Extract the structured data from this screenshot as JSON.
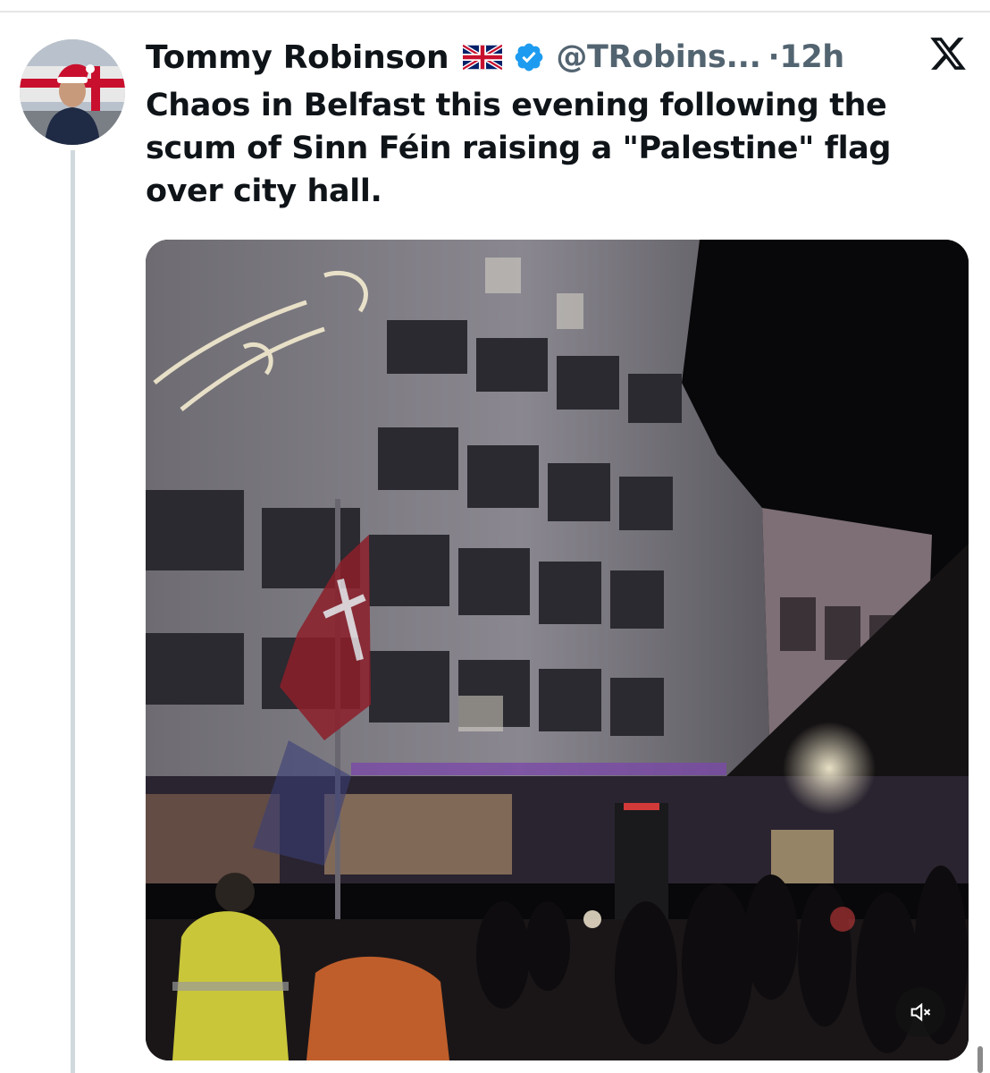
{
  "tweet": {
    "author": {
      "display_name": "Tommy Robinson",
      "handle": "@TRobins...",
      "flag_icon": "union-jack-flag-icon",
      "verified_icon": "verified-badge-icon",
      "verified_color": "#1d9bf0"
    },
    "separator": "·",
    "timestamp": "12h",
    "text": "Chaos in Belfast this evening following the scum of Sinn Féin raising a \"Palestine\" flag over city hall.",
    "media": {
      "type": "video",
      "mute_icon": "volume-muted-icon"
    }
  },
  "app": {
    "logo_icon": "x-logo-icon"
  },
  "colors": {
    "text_primary": "#0f1419",
    "text_secondary": "#536471",
    "accent": "#1d9bf0",
    "thread_line": "#cfd9de"
  }
}
